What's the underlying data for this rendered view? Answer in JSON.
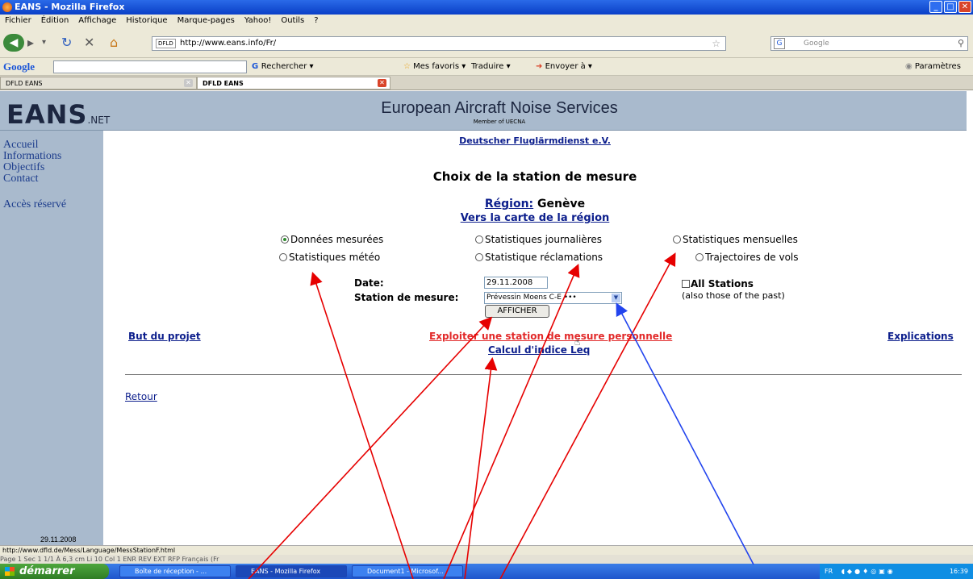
{
  "window": {
    "title": "EANS - Mozilla Firefox"
  },
  "menu": [
    "Fichier",
    "Édition",
    "Affichage",
    "Historique",
    "Marque-pages",
    "Yahoo!",
    "Outils",
    "?"
  ],
  "navbar": {
    "site_badge": "DFLD",
    "url": "http://www.eans.info/Fr/",
    "search_placeholder": "Google"
  },
  "googlebar": {
    "logo": "Google",
    "search": "Rechercher",
    "favoris": "Mes favoris",
    "traduire": "Traduire",
    "envoyer": "Envoyer à",
    "parametres": "Paramètres"
  },
  "tabs": [
    {
      "label": "DFLD EANS"
    },
    {
      "label": "DFLD EANS"
    }
  ],
  "header": {
    "logo": "EANS",
    "logo_suffix": ".NET",
    "title": "European Aircraft Noise Services",
    "member": "Member of UECNA"
  },
  "sidebar": {
    "items": [
      "Accueil",
      "Informations",
      "Objectifs",
      "Contact",
      "Accès réservé"
    ],
    "date": "29.11.2008"
  },
  "main": {
    "top_link": "Deutscher Fluglärmdienst e.V.",
    "heading": "Choix de la station de mesure",
    "region_label": "Région:",
    "region_value": "Genève",
    "map_link": "Vers la carte de la région",
    "radios": [
      {
        "label": "Données mesurées",
        "checked": true
      },
      {
        "label": "Statistiques journalières",
        "checked": false
      },
      {
        "label": "Statistiques mensuelles",
        "checked": false
      },
      {
        "label": "Statistiques météo",
        "checked": false
      },
      {
        "label": "Statistique réclamations",
        "checked": false
      },
      {
        "label": "Trajectoires de vols",
        "checked": false
      }
    ],
    "date_label": "Date:",
    "date_value": "29.11.2008",
    "station_label": "Station de mesure:",
    "station_value": "Prévessin Moens C-E •••",
    "all_stations_label": "All Stations",
    "all_stations_note": "(also those of the past)",
    "submit": "AFFICHER",
    "but_link": "But du projet",
    "exploit_link": "Exploiter une station de mesure personnelle",
    "calcul_link": "Calcul d'indice Leq",
    "explications_link": "Explications",
    "retour_link": "Retour"
  },
  "statusbar": {
    "url": "http://www.dfld.de/Mess/Language/MessStationF.html"
  },
  "wordbar": {
    "text": "Page 1     Sec 1     1/1     À 6,3 cm   Li 10   Col 1        ENR  REV  EXT  RFP   Français (Fr"
  },
  "taskbar": {
    "start": "démarrer",
    "tasks": [
      "Boîte de réception - ...",
      "EANS - Mozilla Firefox",
      "Document1 - Microsof..."
    ],
    "tray_lang": "FR",
    "clock": "16:39"
  },
  "colors": {
    "header_bg": "#a9bacd",
    "link": "#0c1e8c",
    "annotation_red": "#e60000",
    "annotation_blue": "#2244ee"
  }
}
